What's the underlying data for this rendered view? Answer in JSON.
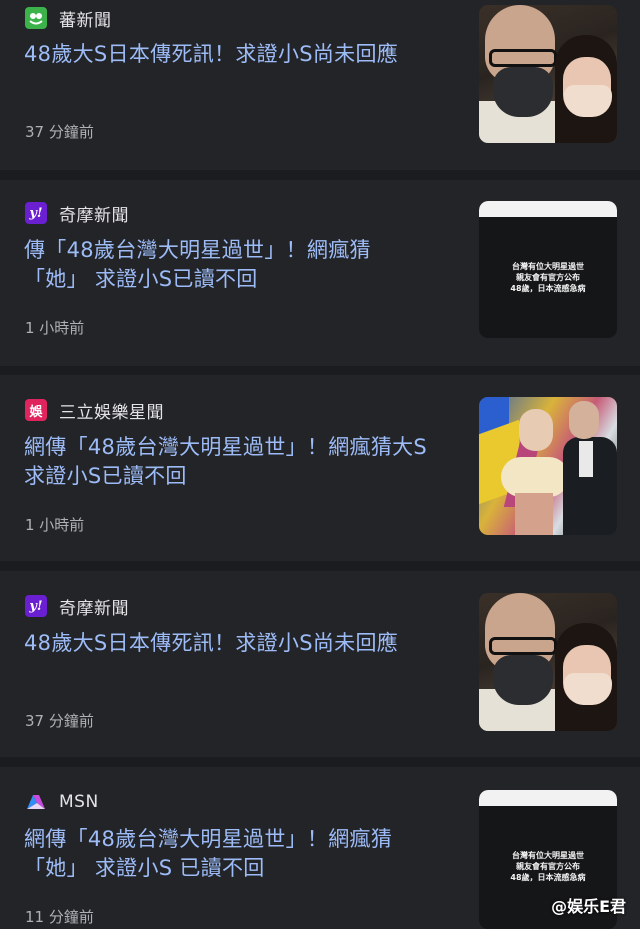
{
  "cards": [
    {
      "source": "蕃新聞",
      "logo_icon": "lettuce-app-icon",
      "headline": "48歲大S日本傳死訊！求證小S尚未回應",
      "time": "37 分鐘前",
      "thumb_type": "photo-couple"
    },
    {
      "source": "奇摩新聞",
      "logo_icon": "yahoo-icon",
      "logo_glyph": "y!",
      "headline": "傳「48歲台灣大明星過世」！網瘋猜「她」 求證小S已讀不回",
      "time": "1 小時前",
      "thumb_type": "phone-screen",
      "thumb_lines": [
        "台灣有位大明星過世",
        "親友會有官方公布",
        "48歲，日本流感急病"
      ]
    },
    {
      "source": "三立娛樂星聞",
      "logo_icon": "sanli-entertainment-icon",
      "logo_glyph": "娛",
      "headline": "網傳「48歲台灣大明星過世」！網瘋猜大S 求證小S已讀不回",
      "time": "1 小時前",
      "thumb_type": "photo-event"
    },
    {
      "source": "奇摩新聞",
      "logo_icon": "yahoo-icon",
      "logo_glyph": "y!",
      "headline": "48歲大S日本傳死訊！求證小S尚未回應",
      "time": "37 分鐘前",
      "thumb_type": "photo-couple"
    },
    {
      "source": "MSN",
      "logo_icon": "msn-icon",
      "headline": "網傳「48歲台灣大明星過世」！網瘋猜「她」 求證小S 已讀不回",
      "time": "11 分鐘前",
      "thumb_type": "phone-screen",
      "thumb_lines": [
        "台灣有位大明星過世",
        "親友會有官方公布",
        "48歲，日本流感急病"
      ]
    }
  ],
  "watermark": "@娱乐E君",
  "colors": {
    "background": "#1b1c1f",
    "card": "#232428",
    "headline": "#9dbcf7",
    "meta": "#aeb0b5"
  }
}
